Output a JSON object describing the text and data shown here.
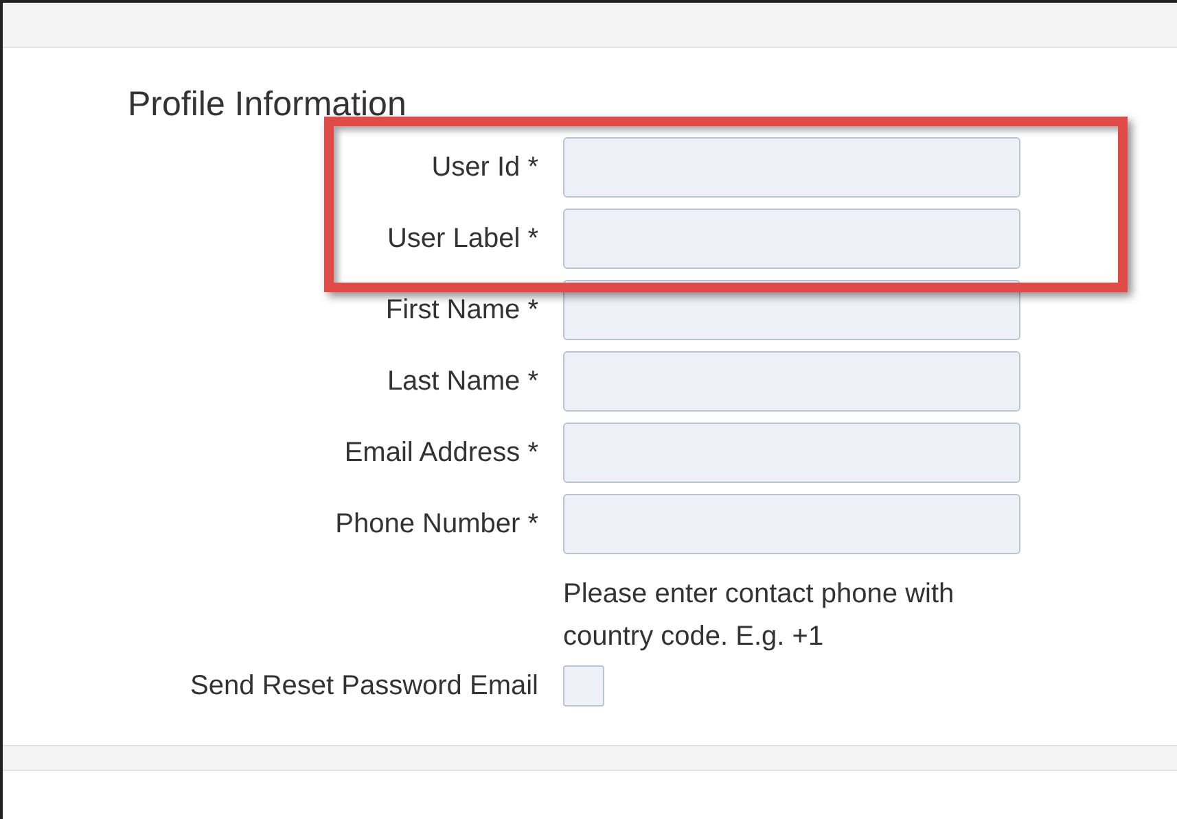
{
  "section": {
    "title": "Profile Information"
  },
  "highlighted_fields": [
    {
      "label": "User Id *"
    },
    {
      "label": "User Label *"
    }
  ],
  "fields": [
    {
      "label": "First Name *"
    },
    {
      "label": "Last Name *"
    },
    {
      "label": "Email Address *"
    },
    {
      "label": "Phone Number *"
    }
  ],
  "help_text": "Please enter contact phone with country code. E.g. +1",
  "reset_option": {
    "label": "Send Reset Password Email",
    "checked": false
  }
}
